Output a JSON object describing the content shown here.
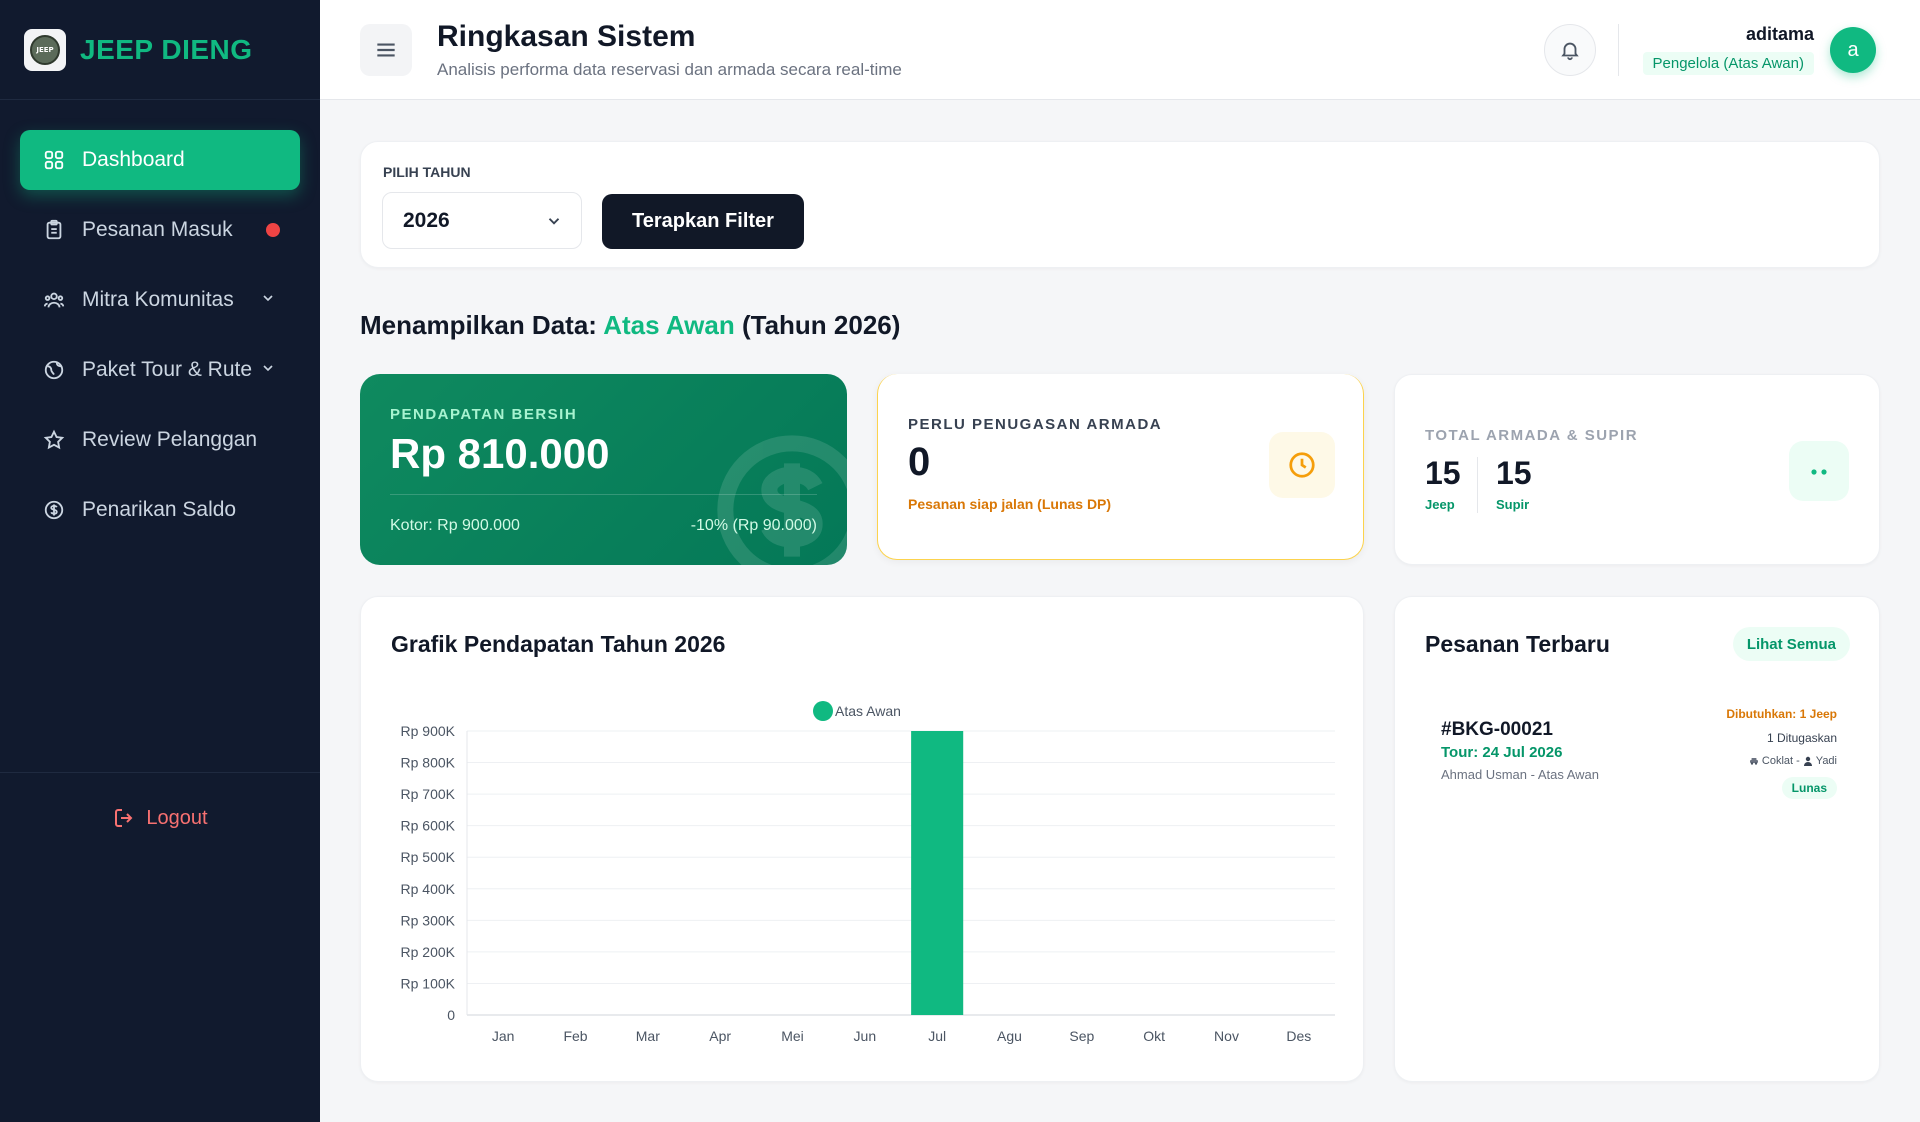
{
  "brand": {
    "name": "JEEP DIENG",
    "logo_text": "JEEP"
  },
  "sidebar": {
    "items": [
      {
        "label": "Dashboard"
      },
      {
        "label": "Pesanan Masuk"
      },
      {
        "label": "Mitra Komunitas"
      },
      {
        "label": "Paket Tour & Rute"
      },
      {
        "label": "Review Pelanggan"
      },
      {
        "label": "Penarikan Saldo"
      }
    ],
    "logout": "Logout"
  },
  "header": {
    "title": "Ringkasan Sistem",
    "subtitle": "Analisis performa data reservasi dan armada secara real-time",
    "user_name": "aditama",
    "user_role": "Pengelola (Atas Awan)",
    "avatar_letter": "a"
  },
  "filter": {
    "label": "PILIH TAHUN",
    "year": "2026",
    "apply": "Terapkan Filter"
  },
  "section": {
    "prefix": "Menampilkan Data:",
    "location": "Atas Awan",
    "suffix": "(Tahun 2026)"
  },
  "stats": {
    "income": {
      "label": "PENDAPATAN BERSIH",
      "value": "Rp 810.000",
      "gross": "Kotor: Rp 900.000",
      "fee": "-10% (Rp 90.000)"
    },
    "assign": {
      "label": "PERLU PENUGASAN ARMADA",
      "value": "0",
      "note": "Pesanan siap jalan (Lunas DP)"
    },
    "fleet": {
      "label": "TOTAL ARMADA & SUPIR",
      "jeep_count": "15",
      "jeep_label": "Jeep",
      "driver_count": "15",
      "driver_label": "Supir"
    }
  },
  "chart_card": {
    "title": "Grafik Pendapatan Tahun 2026"
  },
  "chart_data": {
    "type": "bar",
    "title": "Grafik Pendapatan Tahun 2026",
    "categories": [
      "Jan",
      "Feb",
      "Mar",
      "Apr",
      "Mei",
      "Jun",
      "Jul",
      "Agu",
      "Sep",
      "Okt",
      "Nov",
      "Des"
    ],
    "series": [
      {
        "name": "Atas Awan",
        "values": [
          0,
          0,
          0,
          0,
          0,
          0,
          900000,
          0,
          0,
          0,
          0,
          0
        ],
        "color": "#10b981"
      }
    ],
    "ylim": [
      0,
      900000
    ],
    "yticks": [
      "0",
      "Rp 100K",
      "Rp 200K",
      "Rp 300K",
      "Rp 400K",
      "Rp 500K",
      "Rp 600K",
      "Rp 700K",
      "Rp 800K",
      "Rp 900K"
    ],
    "legend": "top-center",
    "grid": true
  },
  "orders": {
    "title": "Pesanan Terbaru",
    "see_all": "Lihat Semua",
    "items": [
      {
        "id": "#BKG-00021",
        "tour": "Tour: 24 Jul 2026",
        "customer": "Ahmad Usman - Atas Awan",
        "needed": "Dibutuhkan: 1 Jeep",
        "assigned": "1 Ditugaskan",
        "jeep": "Coklat -",
        "driver": "Yadi",
        "status": "Lunas"
      }
    ]
  }
}
